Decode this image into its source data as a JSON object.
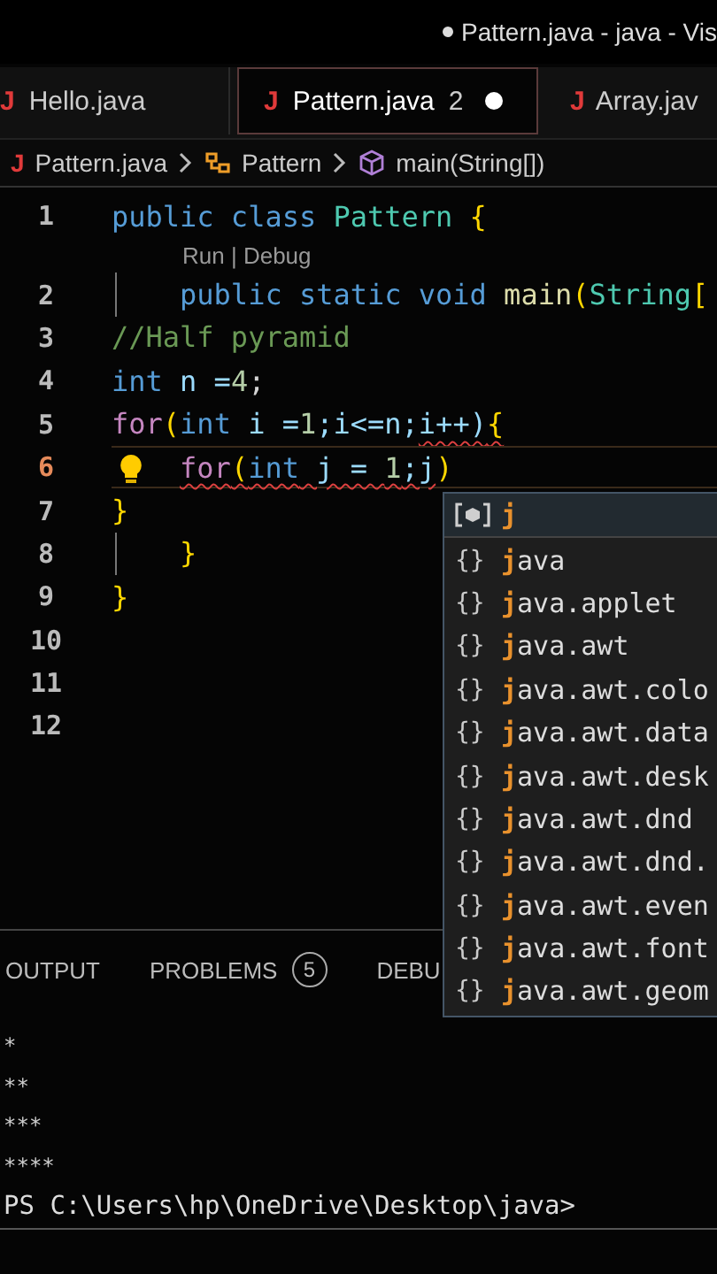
{
  "window": {
    "title": "Pattern.java - java - Vis",
    "modified": true
  },
  "tabs": [
    {
      "icon": "J",
      "label": "Hello.java",
      "selected": false,
      "modified": false
    },
    {
      "icon": "J",
      "label": "Pattern.java",
      "problems": "2",
      "selected": true,
      "modified": true
    },
    {
      "icon": "J",
      "label": "Array.jav",
      "selected": false,
      "modified": false
    }
  ],
  "breadcrumb": [
    {
      "kind": "file",
      "icon": "J",
      "label": "Pattern.java"
    },
    {
      "kind": "class",
      "label": "Pattern"
    },
    {
      "kind": "method",
      "label": "main(String[])"
    }
  ],
  "editor": {
    "lines": [
      {
        "kind": "code",
        "number": "1",
        "tokens": [
          {
            "text": "public",
            "kind": "keyword"
          },
          {
            "text": " class",
            "kind": "keyword"
          },
          {
            "text": " Pattern",
            "kind": "type"
          },
          {
            "text": " {",
            "kind": "brace"
          }
        ]
      },
      {
        "kind": "codelens",
        "text": "Run | Debug"
      },
      {
        "kind": "code",
        "number": "2",
        "guide": true,
        "tokens": [
          {
            "text": "    public static void",
            "kind": "keyword"
          },
          {
            "text": " main",
            "kind": "method"
          },
          {
            "text": "(",
            "kind": "brace"
          },
          {
            "text": "String",
            "kind": "type"
          },
          {
            "text": "[",
            "kind": "brace"
          }
        ]
      },
      {
        "kind": "code",
        "number": "3",
        "tokens": [
          {
            "text": "//Half pyramid",
            "kind": "comment"
          }
        ]
      },
      {
        "kind": "code",
        "number": "4",
        "tokens": [
          {
            "text": "int",
            "kind": "keyword"
          },
          {
            "text": " n =",
            "kind": "variable"
          },
          {
            "text": "4",
            "kind": "number"
          },
          {
            "text": ";",
            "kind": "plain"
          }
        ]
      },
      {
        "kind": "code",
        "number": "5",
        "tokens": [
          {
            "text": "for",
            "kind": "control"
          },
          {
            "text": "(",
            "kind": "brace"
          },
          {
            "text": "int",
            "kind": "keyword"
          },
          {
            "text": " i =",
            "kind": "variable"
          },
          {
            "text": "1",
            "kind": "number"
          },
          {
            "text": ";i<=n;",
            "kind": "variable"
          },
          {
            "text": "i++)",
            "kind": "variable",
            "error": true
          },
          {
            "text": "{",
            "kind": "brace",
            "error": true
          }
        ]
      },
      {
        "kind": "code",
        "number": "6",
        "current": true,
        "lightbulb": true,
        "tokens": [
          {
            "text": "    for",
            "kind": "control",
            "error": true
          },
          {
            "text": "(",
            "kind": "brace",
            "error": true
          },
          {
            "text": "int",
            "kind": "keyword",
            "error": true
          },
          {
            "text": " j = ",
            "kind": "variable",
            "error": true
          },
          {
            "text": "1",
            "kind": "number",
            "error": true
          },
          {
            "text": ";j",
            "kind": "variable",
            "error": true
          },
          {
            "text": ")",
            "kind": "brace"
          }
        ]
      },
      {
        "kind": "code",
        "number": "7",
        "tokens": [
          {
            "text": "}",
            "kind": "brace"
          }
        ]
      },
      {
        "kind": "code",
        "number": "8",
        "guide": true,
        "tokens": [
          {
            "text": "    }",
            "kind": "brace"
          }
        ]
      },
      {
        "kind": "code",
        "number": "9",
        "tokens": [
          {
            "text": "}",
            "kind": "brace"
          }
        ]
      },
      {
        "kind": "code",
        "number": "10"
      },
      {
        "kind": "code",
        "number": "11"
      },
      {
        "kind": "code",
        "number": "12"
      }
    ]
  },
  "suggestions": [
    {
      "kind": "variable",
      "match": "j",
      "selected": true
    },
    {
      "kind": "module",
      "icon": "{}",
      "match": "j",
      "rest": "ava",
      "selected": false
    },
    {
      "kind": "module",
      "icon": "{}",
      "match": "j",
      "rest": "ava.applet",
      "selected": false
    },
    {
      "kind": "module",
      "icon": "{}",
      "match": "j",
      "rest": "ava.awt",
      "selected": false
    },
    {
      "kind": "module",
      "icon": "{}",
      "match": "j",
      "rest": "ava.awt.colo",
      "selected": false
    },
    {
      "kind": "module",
      "icon": "{}",
      "match": "j",
      "rest": "ava.awt.data",
      "selected": false
    },
    {
      "kind": "module",
      "icon": "{}",
      "match": "j",
      "rest": "ava.awt.desk",
      "selected": false
    },
    {
      "kind": "module",
      "icon": "{}",
      "match": "j",
      "rest": "ava.awt.dnd",
      "selected": false
    },
    {
      "kind": "module",
      "icon": "{}",
      "match": "j",
      "rest": "ava.awt.dnd.",
      "selected": false
    },
    {
      "kind": "module",
      "icon": "{}",
      "match": "j",
      "rest": "ava.awt.even",
      "selected": false
    },
    {
      "kind": "module",
      "icon": "{}",
      "match": "j",
      "rest": "ava.awt.font",
      "selected": false
    },
    {
      "kind": "module",
      "icon": "{}",
      "match": "j",
      "rest": "ava.awt.geom",
      "selected": false
    }
  ],
  "panel": {
    "tabs": [
      {
        "label": "OUTPUT",
        "selected": false
      },
      {
        "label": "PROBLEMS",
        "badge": "5",
        "selected": false
      },
      {
        "label": "DEBU",
        "selected": false
      }
    ],
    "output": [
      "*",
      "**",
      "***",
      "****"
    ],
    "prompt": "PS C:\\Users\\hp\\OneDrive\\Desktop\\java>"
  }
}
